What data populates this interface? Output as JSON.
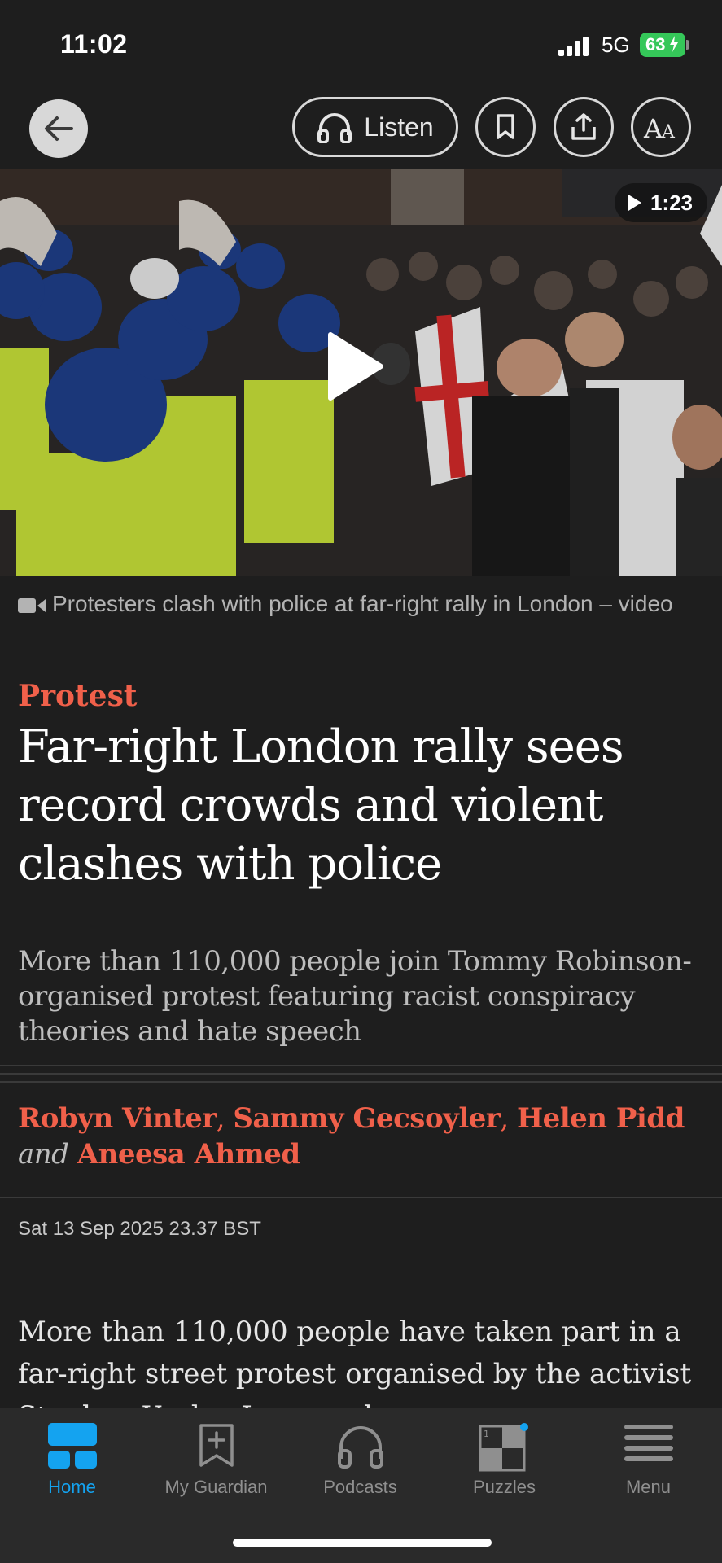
{
  "status": {
    "time": "11:02",
    "network": "5G",
    "battery": "63"
  },
  "toolbar": {
    "listen_label": "Listen"
  },
  "video": {
    "duration": "1:23",
    "caption": "Protesters clash with police at far-right rally in London – video"
  },
  "article": {
    "kicker": "Protest",
    "headline": "Far-right London rally sees record crowds and violent clashes with police",
    "standfirst": "More than 110,000 people join Tommy Robinson-organised protest featuring racist conspiracy theories and hate speech",
    "authors": [
      "Robyn Vinter",
      "Sammy Gecsoyler",
      "Helen Pidd",
      "Aneesa Ahmed"
    ],
    "byline_and": "and",
    "dateline": "Sat 13 Sep 2025 23.37 BST",
    "body_start": "More than 110,000 people have taken part in a far-right street protest organised by the activist Stephen Yaxley-Lennon, known as"
  },
  "tabs": [
    {
      "label": "Home",
      "icon": "home-icon"
    },
    {
      "label": "My Guardian",
      "icon": "bookmark-icon"
    },
    {
      "label": "Podcasts",
      "icon": "headphones-icon"
    },
    {
      "label": "Puzzles",
      "icon": "crossword-icon"
    },
    {
      "label": "Menu",
      "icon": "menu-icon"
    }
  ],
  "colors": {
    "accent": "#f0604a",
    "tab_active": "#14a3f0",
    "background": "#1e1e1e"
  }
}
